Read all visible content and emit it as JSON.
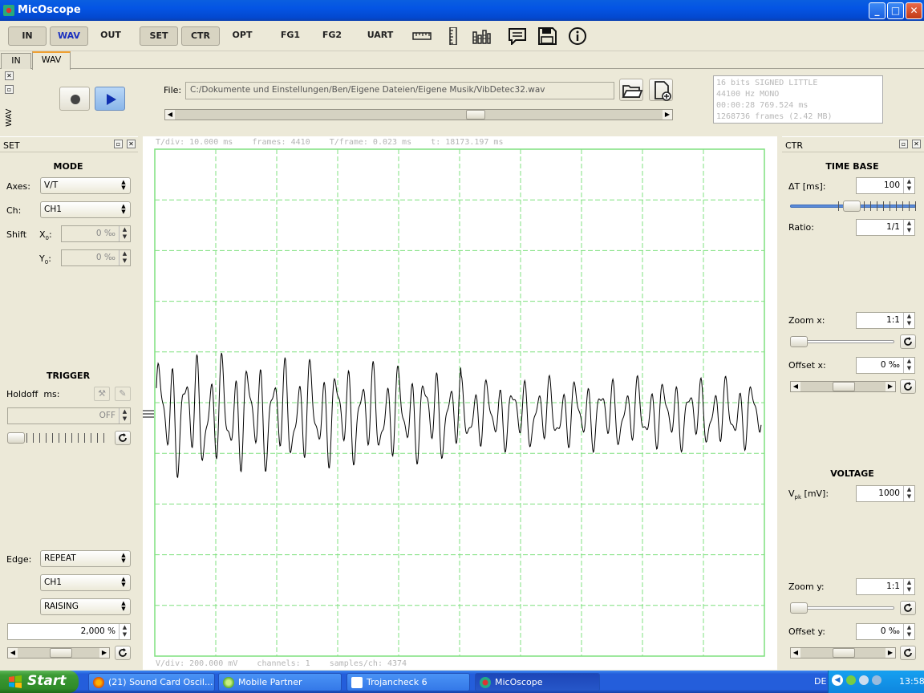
{
  "window": {
    "title": "MicOscope",
    "controls": [
      "_",
      "□",
      "✕"
    ]
  },
  "toolbar": {
    "buttons": [
      "IN",
      "WAV",
      "OUT",
      "SET",
      "CTR",
      "OPT",
      "FG1",
      "FG2",
      "UART"
    ],
    "icons": [
      "ruler-h-icon",
      "ruler-v-icon",
      "spectrum-icon",
      "message-icon",
      "save-icon",
      "info-icon"
    ]
  },
  "tabs": [
    "IN",
    "WAV"
  ],
  "wav": {
    "dock_label": "WAV",
    "file_label": "File:",
    "file_path": "C:/Dokumente und Einstellungen/Ben/Eigene Dateien/Eigene Musik/VibDetec32.wav",
    "file_info": [
      "16 bits SIGNED LITTLE",
      "44100 Hz MONO",
      "00:00:28 769.524 ms",
      "1268736 frames (2.42 MB)"
    ],
    "position_fraction": 0.62
  },
  "set": {
    "title": "SET",
    "mode_title": "MODE",
    "axes_label": "Axes:",
    "axes_value": "V/T",
    "ch_label": "Ch:",
    "ch_value": "CH1",
    "shift_label": "Shift",
    "x0_label": "X",
    "x0_sub": "0",
    "x0_suffix": ":",
    "x0_value": "0 ‰",
    "y0_label": "Y",
    "y0_sub": "0",
    "y0_suffix": ":",
    "y0_value": "0 ‰",
    "trigger_title": "TRIGGER",
    "holdoff_label": "Holdoff  ms:",
    "holdoff_value": "OFF",
    "edge_label": "Edge:",
    "edge_value": "REPEAT",
    "edge_ch": "CH1",
    "edge_slope": "RAISING",
    "level_value": "2,000 %"
  },
  "scope": {
    "top_info": "T/div: 10.000 ms    frames: 4410    T/frame: 0.023 ms    t: 18173.197 ms",
    "bottom_info": "V/div: 200.000 mV    channels: 1    samples/ch: 4374",
    "grid_color": "#7fe07f",
    "trace_color": "#000000"
  },
  "ctr": {
    "title": "CTR",
    "timebase_title": "TIME BASE",
    "dt_label": "ΔT [ms]:",
    "dt_value": "100",
    "ratio_label": "Ratio:",
    "ratio_value": "1/1",
    "zoomx_label": "Zoom x:",
    "zoomx_value": "1:1",
    "offsetx_label": "Offset x:",
    "offsetx_value": "0 ‰",
    "voltage_title": "VOLTAGE",
    "vpk_label": "V",
    "vpk_sub": "pk",
    "vpk_suffix": " [mV]:",
    "vpk_value": "1000",
    "zoomy_label": "Zoom y:",
    "zoomy_value": "1:1",
    "offsety_label": "Offset y:",
    "offsety_value": "0 ‰"
  },
  "taskbar": {
    "start": "Start",
    "tasks": [
      "(21) Sound Card Oscil...",
      "Mobile Partner",
      "Trojancheck 6",
      "MicOscope"
    ],
    "lang": "DE",
    "clock": "13:58"
  }
}
